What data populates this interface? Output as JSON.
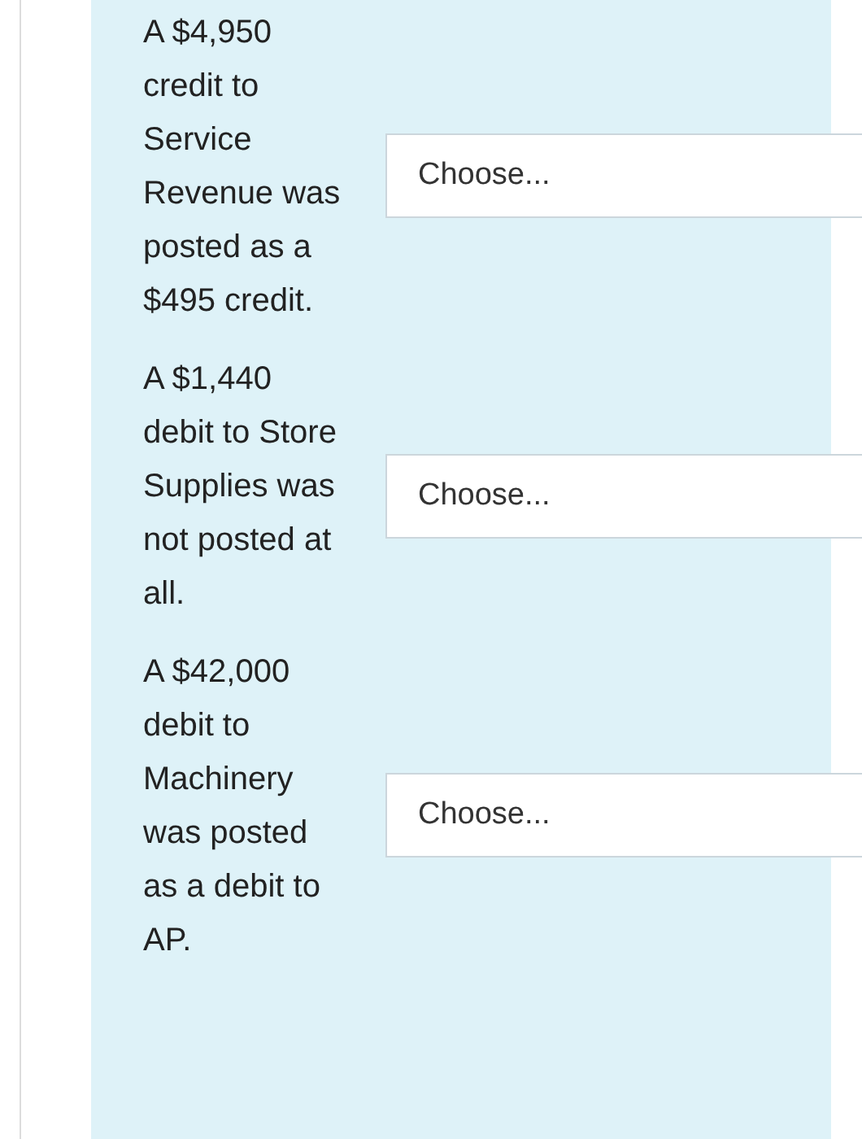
{
  "items": [
    {
      "statement": "A $4,950 credit to Service Revenue was posted as a $495 credit.",
      "select": {
        "placeholder": "Choose..."
      }
    },
    {
      "statement": "A $1,440 debit to Store Supplies was not posted at all.",
      "select": {
        "placeholder": "Choose..."
      }
    },
    {
      "statement": "A $42,000 debit to Machinery was posted as a debit to AP.",
      "select": {
        "placeholder": "Choose..."
      }
    }
  ]
}
